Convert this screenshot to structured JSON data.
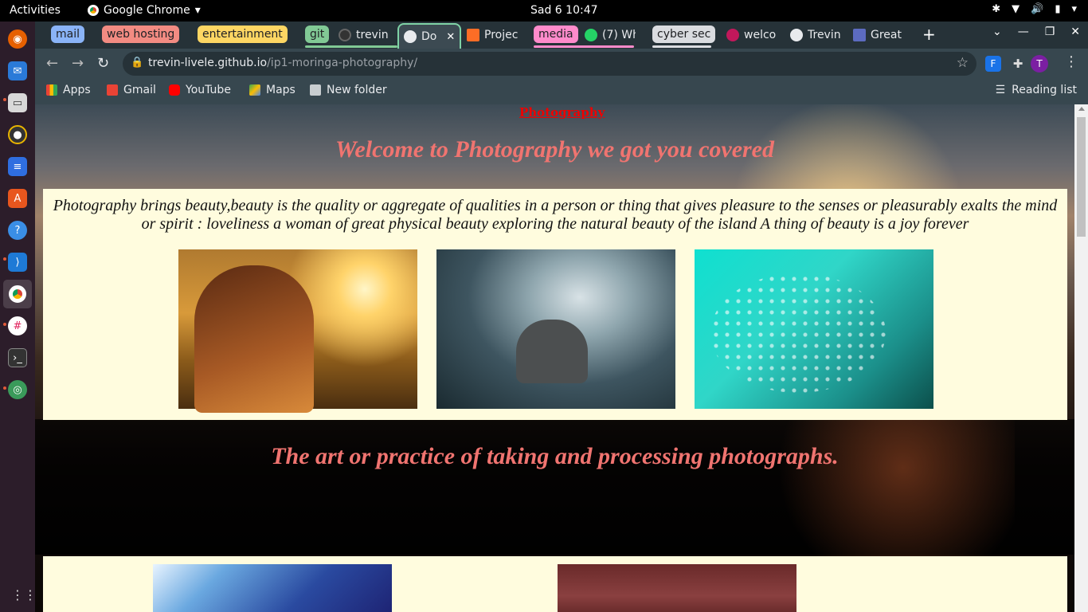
{
  "system": {
    "activities": "Activities",
    "app_name": "Google Chrome",
    "clock": "Sad 6  10:47"
  },
  "tab_groups": [
    {
      "label": "mail",
      "color": "#8ab4f8"
    },
    {
      "label": "web hosting",
      "color": "#f28b82"
    },
    {
      "label": "entertainment",
      "color": "#fdd663"
    },
    {
      "label": "git",
      "color": "#81c995"
    },
    {
      "label": "media",
      "color": "#ff8bcb"
    },
    {
      "label": "cyber sec",
      "color": "#dadce0"
    }
  ],
  "tabs": [
    {
      "title": "trevin"
    },
    {
      "title": "Do",
      "active": true
    },
    {
      "title": "Projec"
    },
    {
      "title": "(7) Wh"
    },
    {
      "title": "welco"
    },
    {
      "title": "Trevin"
    },
    {
      "title": "Great"
    }
  ],
  "address_bar": {
    "host": "trevin-livele.github.io",
    "path": "/ip1-moringa-photography/"
  },
  "profile_initial": "T",
  "bookmarks": [
    "Apps",
    "Gmail",
    "YouTube",
    "Maps",
    "New folder"
  ],
  "reading_list": "Reading list",
  "page": {
    "nav_link": "Photography",
    "welcome_heading": "Welcome to Photography we got you covered",
    "intro_text": "Photography brings beauty,beauty is the quality or aggregate of qualities in a person or thing that gives pleasure to the senses or pleasurably exalts the mind or spirit : loveliness a woman of great physical beauty exploring the natural beauty of the island A thing of beauty is a joy forever",
    "art_heading": "The art or practice of taking and processing photographs."
  }
}
